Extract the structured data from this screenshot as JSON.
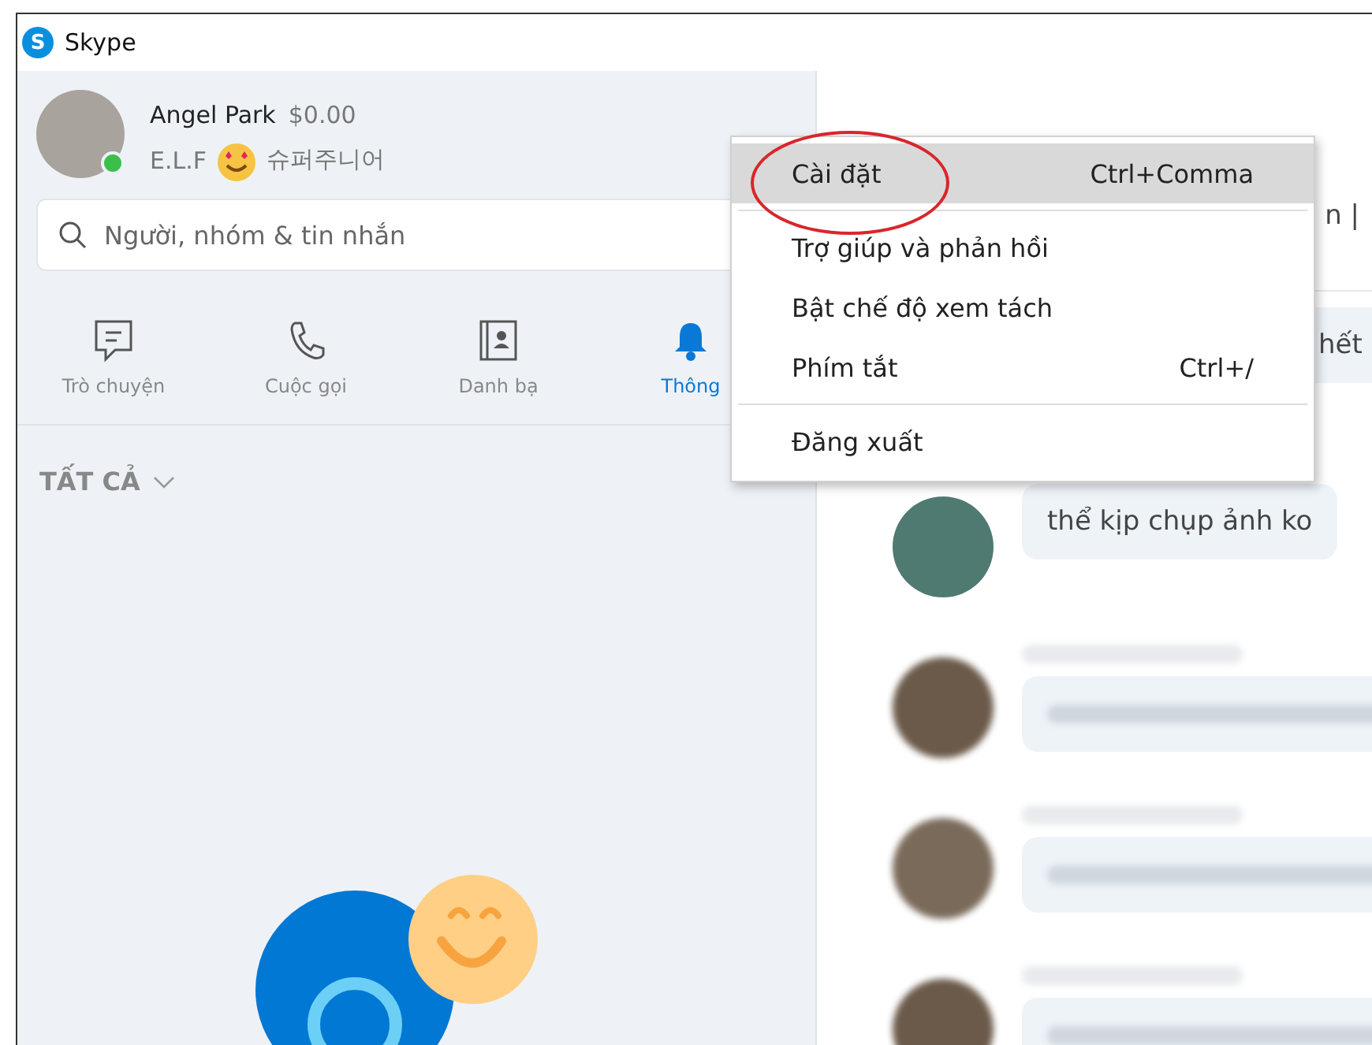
{
  "window": {
    "title": "Skype",
    "logo_letter": "S"
  },
  "profile": {
    "name": "Angel Park",
    "balance": "$0.00",
    "mood_prefix": "E.L.F",
    "mood_text": "슈퍼주니어",
    "online": true
  },
  "search": {
    "placeholder": "Người, nhóm & tin nhắn"
  },
  "tabs": [
    {
      "label": "Trò chuyện",
      "kind": "chat",
      "selected": false
    },
    {
      "label": "Cuộc gọi",
      "kind": "call",
      "selected": false
    },
    {
      "label": "Danh bạ",
      "kind": "contacts",
      "selected": false
    },
    {
      "label": "Thông",
      "kind": "bell",
      "selected": true
    }
  ],
  "filter": {
    "label": "TẤT CẢ"
  },
  "conversation": {
    "header_fragment": "n |",
    "messages": [
      {
        "text": "hết",
        "avatar": false,
        "blurred": false
      },
      {
        "text": "thể kịp chụp ảnh ko",
        "avatar": true,
        "blurred": false
      },
      {
        "avatar": true,
        "blurred": true
      },
      {
        "avatar": true,
        "blurred": true
      },
      {
        "avatar": true,
        "blurred": true
      }
    ]
  },
  "menu": {
    "groups": [
      [
        {
          "label": "Cài đặt",
          "shortcut": "Ctrl+Comma",
          "selected": true,
          "circled": true
        }
      ],
      [
        {
          "label": "Trợ giúp và phản hồi",
          "selected": false
        },
        {
          "label": "Bật chế độ xem tách",
          "selected": false
        },
        {
          "label": "Phím tắt",
          "shortcut": "Ctrl+/",
          "selected": false
        }
      ],
      [
        {
          "label": "Đăng xuất",
          "selected": false
        }
      ]
    ]
  }
}
